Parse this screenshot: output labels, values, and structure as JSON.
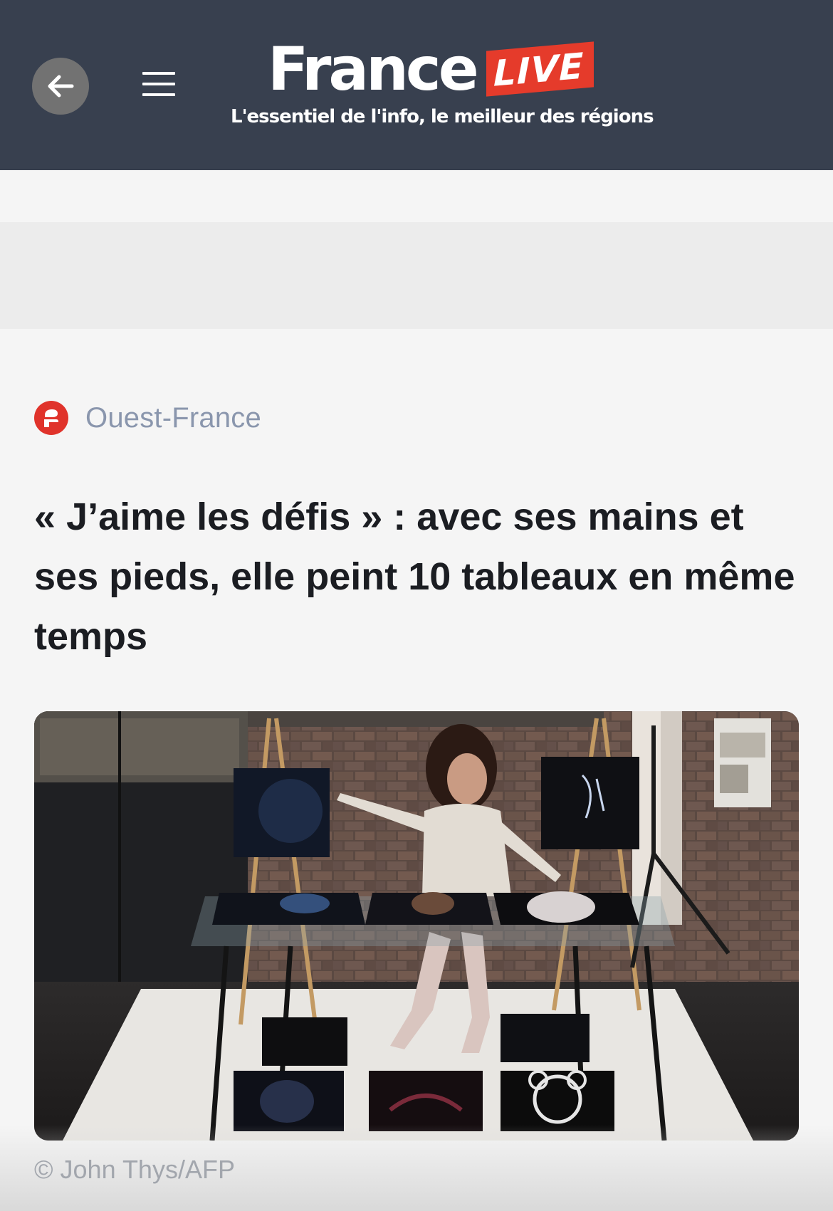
{
  "header": {
    "back_icon": "arrow-left-icon",
    "menu_icon": "hamburger-menu-icon",
    "logo": {
      "brand": "France",
      "badge": "LIVE",
      "tagline": "L'essentiel de l'info, le meilleur des régions"
    },
    "colors": {
      "background": "#38404f",
      "badge": "#e53b2b"
    }
  },
  "article": {
    "source": {
      "name": "Ouest-France",
      "logo_icon": "ouest-france-logo-icon",
      "logo_color": "#e0332b"
    },
    "headline": "« J’aime les défis » : avec ses mains et ses pieds, elle peint 10 tableaux en même temps",
    "image": {
      "credit": "© John Thys/AFP"
    }
  }
}
